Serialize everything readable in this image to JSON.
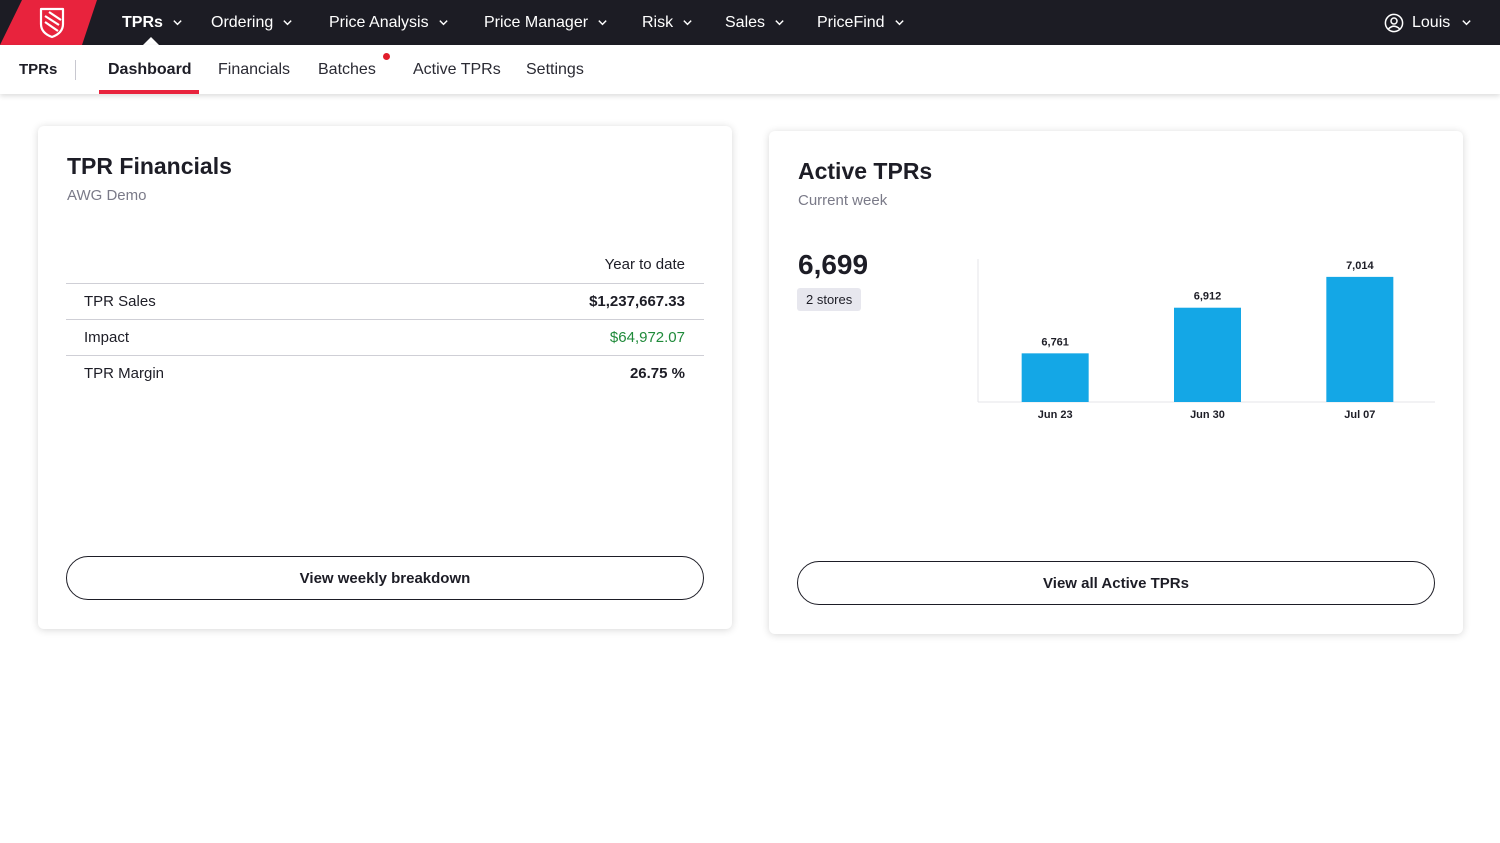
{
  "nav": {
    "items": [
      {
        "label": "TPRs",
        "active": true
      },
      {
        "label": "Ordering"
      },
      {
        "label": "Price Analysis"
      },
      {
        "label": "Price Manager"
      },
      {
        "label": "Risk"
      },
      {
        "label": "Sales"
      },
      {
        "label": "PriceFind"
      }
    ],
    "user": "Louis",
    "brand_color": "#e8233d"
  },
  "subnav": {
    "title": "TPRs",
    "tabs": [
      {
        "label": "Dashboard",
        "active": true
      },
      {
        "label": "Financials"
      },
      {
        "label": "Batches",
        "badge": true
      },
      {
        "label": "Active TPRs"
      },
      {
        "label": "Settings"
      }
    ]
  },
  "financials": {
    "title": "TPR Financials",
    "subtitle": "AWG Demo",
    "column_header": "Year to date",
    "rows": [
      {
        "label": "TPR Sales",
        "value": "$1,237,667.33"
      },
      {
        "label": "Impact",
        "value": "$64,972.07"
      },
      {
        "label": "TPR Margin",
        "value": "26.75 %"
      }
    ],
    "button": "View weekly breakdown"
  },
  "active": {
    "title": "Active TPRs",
    "subtitle": "Current week",
    "count": "6,699",
    "stores": "2 stores",
    "button": "View all Active TPRs"
  },
  "chart_data": {
    "type": "bar",
    "categories": [
      "Jun 23",
      "Jun 30",
      "Jul 07"
    ],
    "values": [
      6761,
      6912,
      7014
    ],
    "value_labels": [
      "6,761",
      "6,912",
      "7,014"
    ],
    "ylim": [
      6600,
      7050
    ],
    "bar_color": "#14a7e6",
    "grid": false
  }
}
